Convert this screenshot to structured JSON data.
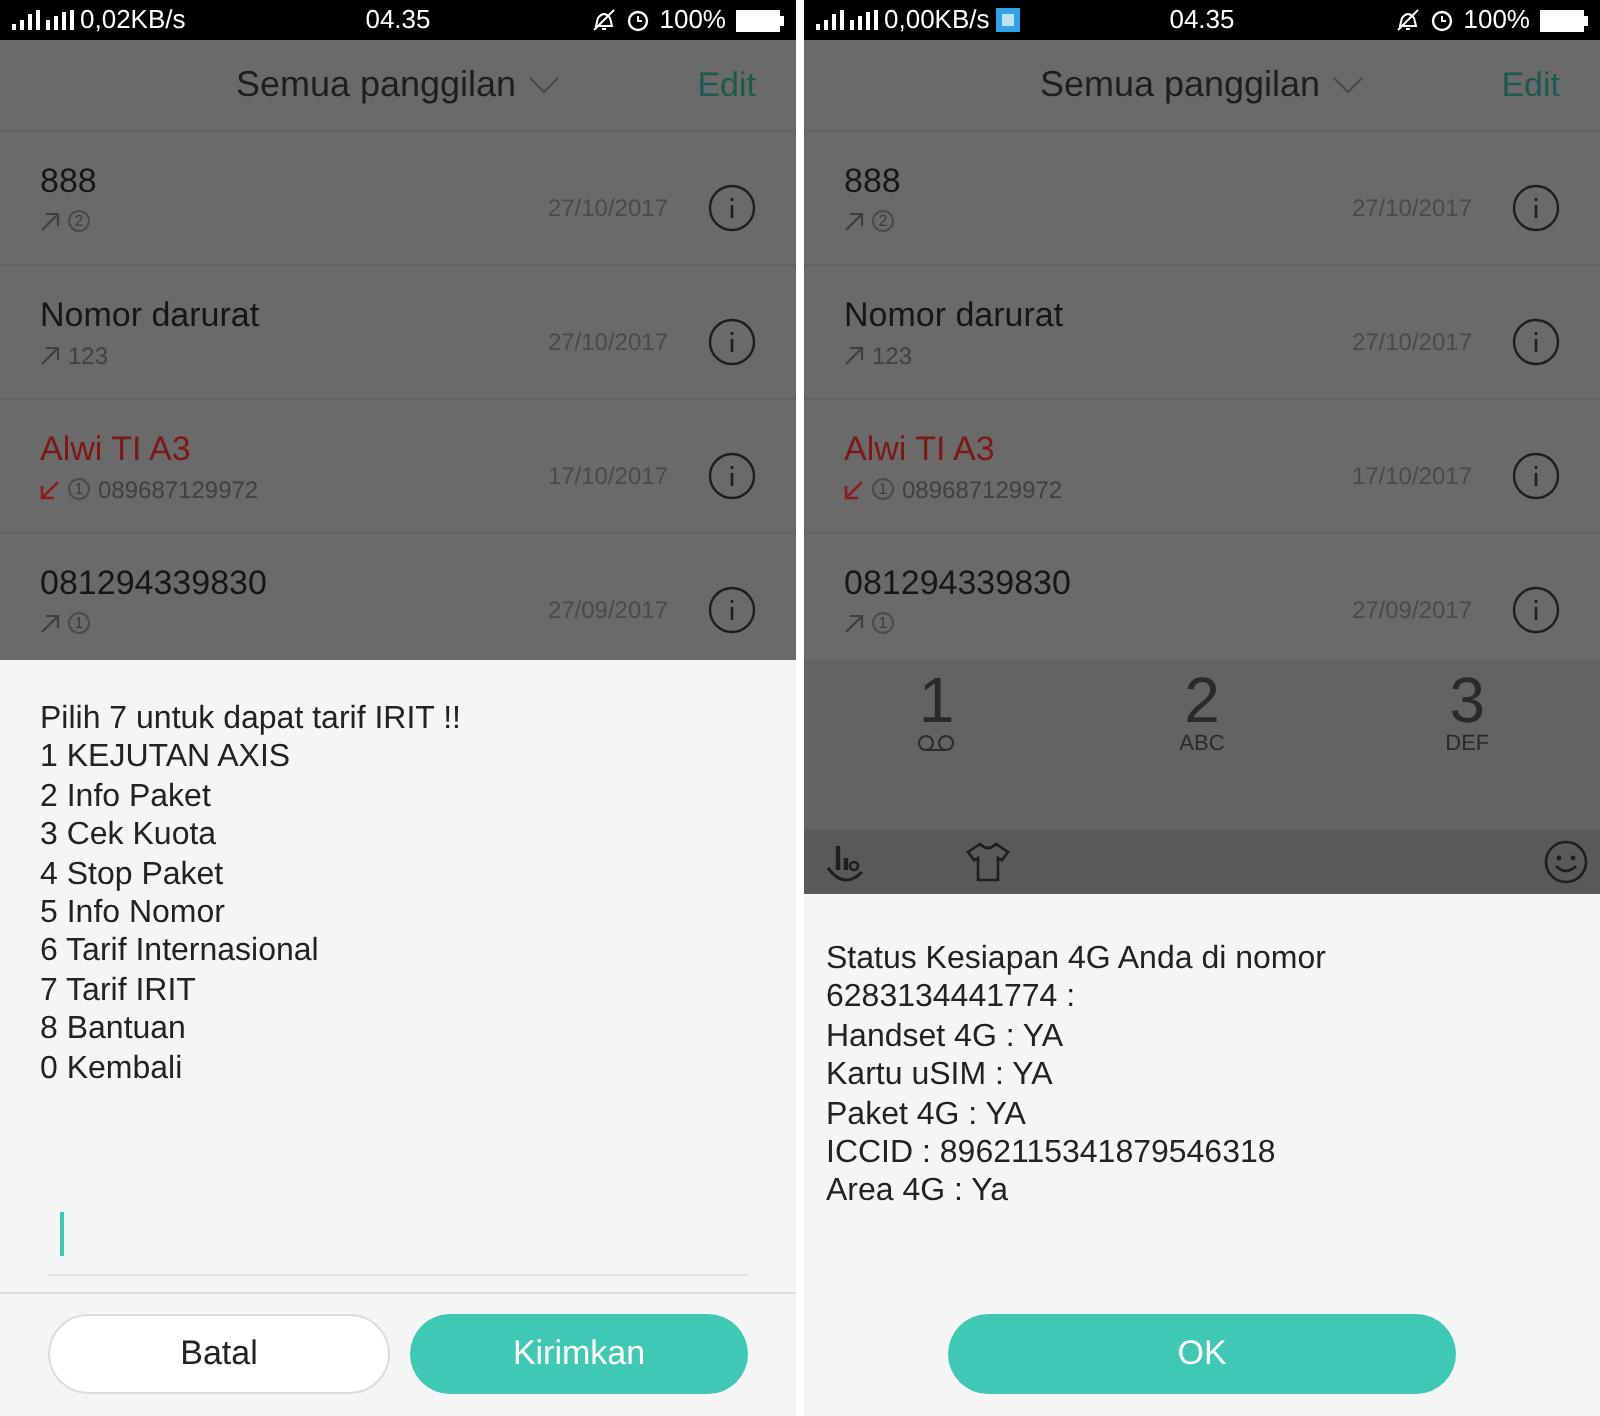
{
  "screens": [
    {
      "status_bar": {
        "speed": "0,02KB/s",
        "notification": false,
        "time": "04.35",
        "battery": "100%"
      },
      "header": {
        "title": "Semua panggilan",
        "action": "Edit"
      },
      "calls": [
        {
          "name": "888",
          "kind": "outgoing",
          "missed": false,
          "sim": "2",
          "date": "27/10/2017"
        },
        {
          "name": "Nomor darurat",
          "kind": "outgoing",
          "missed": false,
          "number": "123",
          "date": "27/10/2017"
        },
        {
          "name": "Alwi TI A3",
          "kind": "incoming",
          "missed": true,
          "sim": "1",
          "number": "089687129972",
          "date": "17/10/2017"
        },
        {
          "name": "081294339830",
          "kind": "outgoing",
          "missed": false,
          "sim": "1",
          "date": "27/09/2017"
        }
      ],
      "dialog": {
        "kind": "ussd_menu",
        "lines": [
          "Pilih 7 untuk dapat tarif IRIT !!",
          "1 KEJUTAN AXIS",
          "2 Info Paket",
          "3 Cek Kuota",
          "4 Stop Paket",
          "5 Info Nomor",
          "6 Tarif Internasional",
          "7 Tarif IRIT",
          "8 Bantuan",
          "0 Kembali"
        ],
        "input": {
          "focused": true
        },
        "buttons": [
          {
            "label": "Batal",
            "primary": false
          },
          {
            "label": "Kirimkan",
            "primary": true
          }
        ]
      }
    },
    {
      "status_bar": {
        "speed": "0,00KB/s",
        "notification": true,
        "time": "04.35",
        "battery": "100%"
      },
      "header": {
        "title": "Semua panggilan",
        "action": "Edit"
      },
      "calls": [
        {
          "name": "888",
          "kind": "outgoing",
          "missed": false,
          "sim": "2",
          "date": "27/10/2017"
        },
        {
          "name": "Nomor darurat",
          "kind": "outgoing",
          "missed": false,
          "number": "123",
          "date": "27/10/2017"
        },
        {
          "name": "Alwi TI A3",
          "kind": "incoming",
          "missed": true,
          "sim": "1",
          "number": "089687129972",
          "date": "17/10/2017"
        },
        {
          "name": "081294339830",
          "kind": "outgoing",
          "missed": false,
          "sim": "1",
          "date": "27/09/2017"
        }
      ],
      "dialpad": [
        {
          "digit": "1",
          "kind": "voicemail"
        },
        {
          "digit": "2",
          "letters": "ABC"
        },
        {
          "digit": "3",
          "letters": "DEF"
        }
      ],
      "keyboard_toolbar": true,
      "dialog": {
        "kind": "ussd_result",
        "lines": [
          "Status Kesiapan 4G Anda di nomor",
          "6283134441774 :",
          "Handset 4G : YA",
          "Kartu uSIM : YA",
          "Paket 4G : YA",
          "ICCID : 8962115341879546318",
          "Area 4G : Ya"
        ],
        "buttons": [
          {
            "label": "OK",
            "primary": true
          }
        ]
      }
    }
  ]
}
